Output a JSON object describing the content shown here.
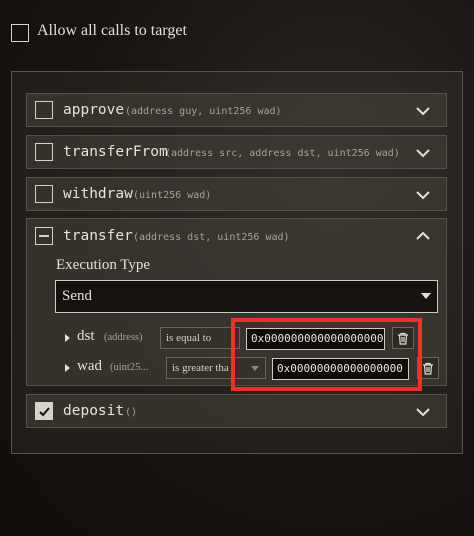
{
  "allow_all": {
    "label": "Allow all calls to target",
    "checked": false
  },
  "functions": [
    {
      "name": "approve",
      "signature": "(address guy, uint256 wad)",
      "state": "unchecked",
      "expanded": false
    },
    {
      "name": "transferFrom",
      "signature": "(address src, address dst, uint256 wad)",
      "state": "unchecked",
      "expanded": false
    },
    {
      "name": "withdraw",
      "signature": "(uint256 wad)",
      "state": "unchecked",
      "expanded": false
    },
    {
      "name": "transfer",
      "signature": "(address dst, uint256 wad)",
      "state": "indeterminate",
      "expanded": true
    },
    {
      "name": "deposit",
      "signature": "()",
      "state": "checked",
      "expanded": false
    }
  ],
  "transfer_details": {
    "execution_type_label": "Execution Type",
    "execution_type_value": "Send",
    "params": [
      {
        "name": "dst",
        "type": "(address)",
        "operator": "is equal to",
        "value": "0x000000000000000000"
      },
      {
        "name": "wad",
        "type": "(uint25...",
        "operator": "is greater tha",
        "value": "0x00000000000000000"
      }
    ]
  },
  "colors": {
    "highlight": "#e8352a",
    "background": "#17130f"
  },
  "icons": {
    "checkbox_checked": "checkmark-icon",
    "chevron": "chevron-down-icon",
    "chevron_up": "chevron-up-icon",
    "delete": "trash-icon"
  }
}
